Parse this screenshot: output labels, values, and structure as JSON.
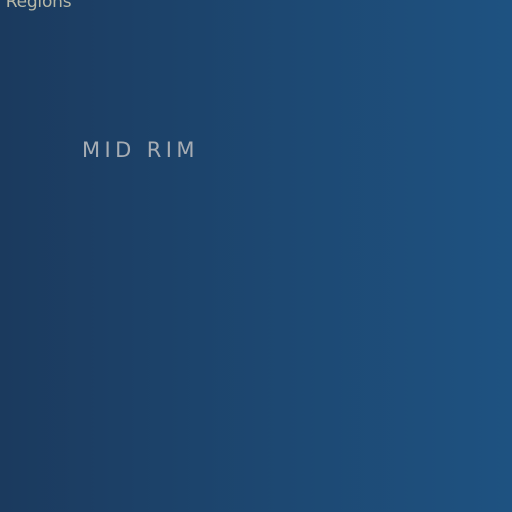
{
  "header": {
    "title": "l Regions"
  },
  "map": {
    "region_label": "MID RIM"
  }
}
